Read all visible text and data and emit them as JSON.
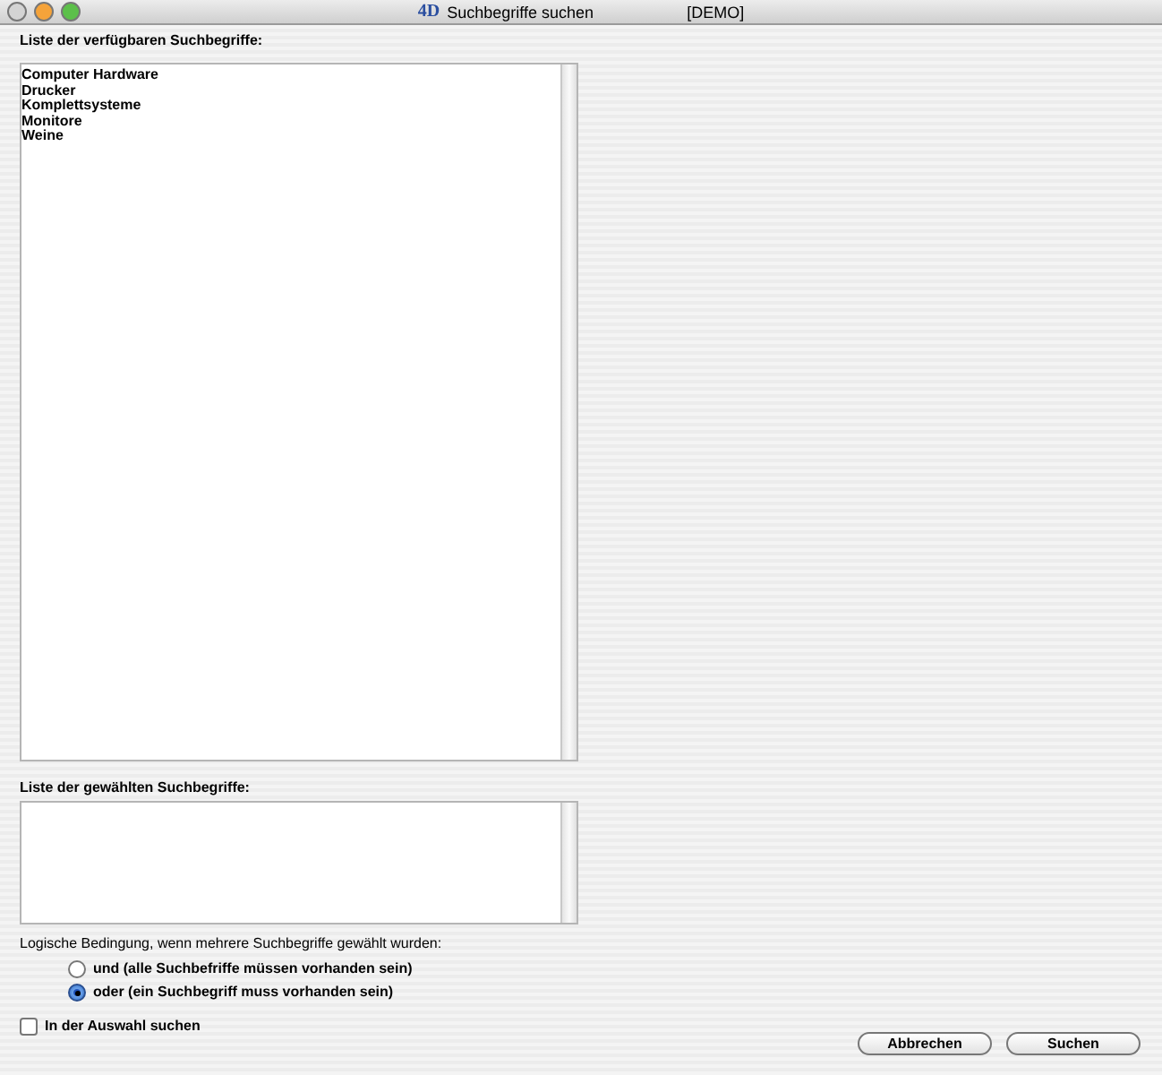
{
  "window": {
    "logo": "4D",
    "title": "Suchbegriffe suchen",
    "tag": "[DEMO]"
  },
  "available": {
    "label": "Liste der verfügbaren Suchbegriffe:",
    "items": [
      "Computer Hardware",
      "Drucker",
      "Komplettsysteme",
      "Monitore",
      "Weine"
    ]
  },
  "chosen": {
    "label": "Liste der gewählten Suchbegriffe:"
  },
  "condition": {
    "label": "Logische Bedingung, wenn mehrere Suchbegriffe gewählt wurden:",
    "options": [
      {
        "label": "und (alle Suchbefriffe müssen vorhanden sein)",
        "selected": false
      },
      {
        "label": "oder (ein Suchbegriff muss vorhanden sein)",
        "selected": true
      }
    ]
  },
  "in_selection": {
    "label": "In der Auswahl suchen",
    "checked": false
  },
  "buttons": [
    "Abbrechen",
    "Suchen"
  ]
}
